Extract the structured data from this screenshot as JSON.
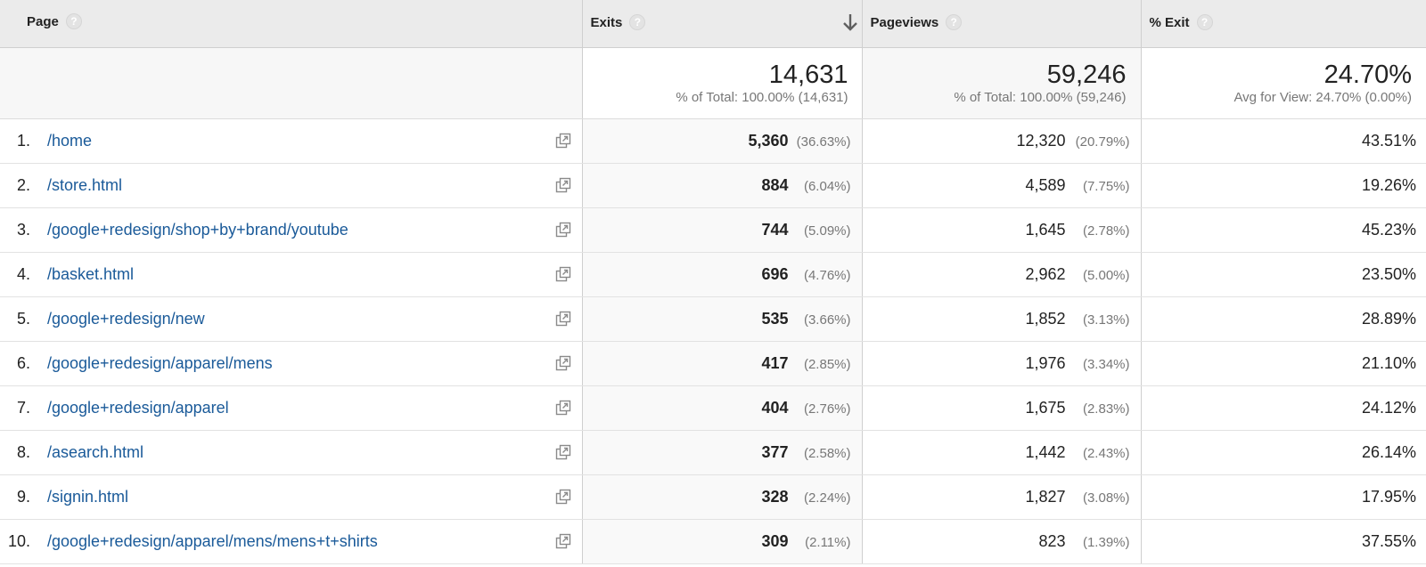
{
  "header": {
    "page_label": "Page",
    "exits_label": "Exits",
    "pageviews_label": "Pageviews",
    "exit_pct_label": "% Exit",
    "help_glyph": "?",
    "sort_icon": "arrow-down-icon"
  },
  "totals": {
    "exits": {
      "value": "14,631",
      "sub": "% of Total: 100.00% (14,631)"
    },
    "pageviews": {
      "value": "59,246",
      "sub": "% of Total: 100.00% (59,246)"
    },
    "exit_pct": {
      "value": "24.70%",
      "sub": "Avg for View: 24.70% (0.00%)"
    }
  },
  "rows": [
    {
      "rank": "1.",
      "page": "/home",
      "exits": "5,360",
      "exits_pct": "(36.63%)",
      "pageviews": "12,320",
      "pageviews_pct": "(20.79%)",
      "exit_pct": "43.51%"
    },
    {
      "rank": "2.",
      "page": "/store.html",
      "exits": "884",
      "exits_pct": "(6.04%)",
      "pageviews": "4,589",
      "pageviews_pct": "(7.75%)",
      "exit_pct": "19.26%"
    },
    {
      "rank": "3.",
      "page": "/google+redesign/shop+by+brand/youtube",
      "exits": "744",
      "exits_pct": "(5.09%)",
      "pageviews": "1,645",
      "pageviews_pct": "(2.78%)",
      "exit_pct": "45.23%"
    },
    {
      "rank": "4.",
      "page": "/basket.html",
      "exits": "696",
      "exits_pct": "(4.76%)",
      "pageviews": "2,962",
      "pageviews_pct": "(5.00%)",
      "exit_pct": "23.50%"
    },
    {
      "rank": "5.",
      "page": "/google+redesign/new",
      "exits": "535",
      "exits_pct": "(3.66%)",
      "pageviews": "1,852",
      "pageviews_pct": "(3.13%)",
      "exit_pct": "28.89%"
    },
    {
      "rank": "6.",
      "page": "/google+redesign/apparel/mens",
      "exits": "417",
      "exits_pct": "(2.85%)",
      "pageviews": "1,976",
      "pageviews_pct": "(3.34%)",
      "exit_pct": "21.10%"
    },
    {
      "rank": "7.",
      "page": "/google+redesign/apparel",
      "exits": "404",
      "exits_pct": "(2.76%)",
      "pageviews": "1,675",
      "pageviews_pct": "(2.83%)",
      "exit_pct": "24.12%"
    },
    {
      "rank": "8.",
      "page": "/asearch.html",
      "exits": "377",
      "exits_pct": "(2.58%)",
      "pageviews": "1,442",
      "pageviews_pct": "(2.43%)",
      "exit_pct": "26.14%"
    },
    {
      "rank": "9.",
      "page": "/signin.html",
      "exits": "328",
      "exits_pct": "(2.24%)",
      "pageviews": "1,827",
      "pageviews_pct": "(3.08%)",
      "exit_pct": "17.95%"
    },
    {
      "rank": "10.",
      "page": "/google+redesign/apparel/mens/mens+t+shirts",
      "exits": "309",
      "exits_pct": "(2.11%)",
      "pageviews": "823",
      "pageviews_pct": "(1.39%)",
      "exit_pct": "37.55%"
    }
  ],
  "icons": {
    "row_action": "open-in-new-window-icon",
    "help": "help-icon"
  },
  "colors": {
    "link": "#1a5a99",
    "header_bg": "#ebebeb",
    "muted": "#777777"
  }
}
